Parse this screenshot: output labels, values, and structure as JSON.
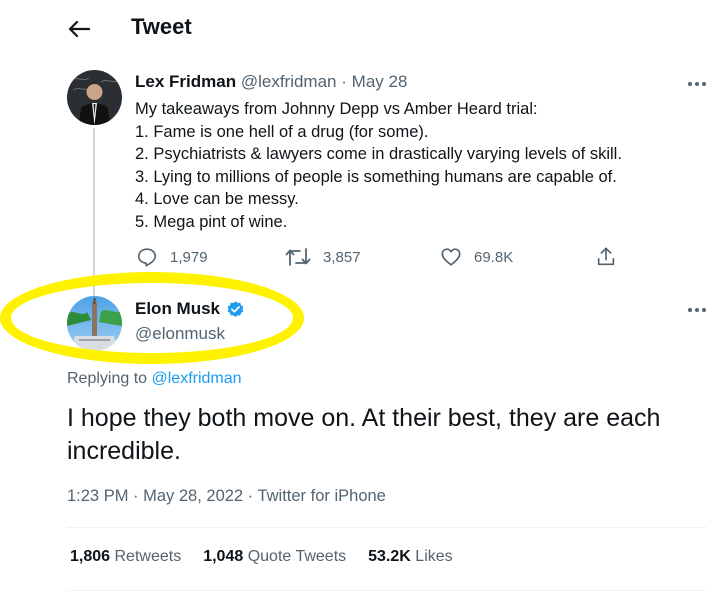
{
  "header": {
    "title": "Tweet"
  },
  "parent_tweet": {
    "author_name": "Lex Fridman",
    "author_handle": "@lexfridman",
    "separator": "·",
    "date": "May 28",
    "lines": [
      "My takeaways from Johnny Depp vs Amber Heard trial:",
      "1. Fame is one hell of a drug (for some).",
      "2. Psychiatrists & lawyers come in drastically varying levels of skill.",
      "3. Lying to millions of people is something humans are capable of.",
      "4. Love can be messy.",
      "5. Mega pint of wine."
    ],
    "actions": {
      "replies": "1,979",
      "retweets": "3,857",
      "likes": "69.8K"
    }
  },
  "main_tweet": {
    "author_name": "Elon Musk",
    "author_handle": "@elonmusk",
    "verified": true,
    "replying_prefix": "Replying to",
    "replying_to": "@lexfridman",
    "text": "I hope they both move on. At their best, they are each incredible.",
    "meta": "1:23 PM · May 28, 2022 · Twitter for iPhone",
    "stats": {
      "retweets_count": "1,806",
      "retweets_label": "Retweets",
      "quote_count": "1,048",
      "quote_label": "Quote Tweets",
      "likes_count": "53.2K",
      "likes_label": "Likes"
    }
  },
  "colors": {
    "highlight": "#fff200",
    "link": "#1d9bf0",
    "verified": "#1d9bf0",
    "muted": "#536471"
  }
}
